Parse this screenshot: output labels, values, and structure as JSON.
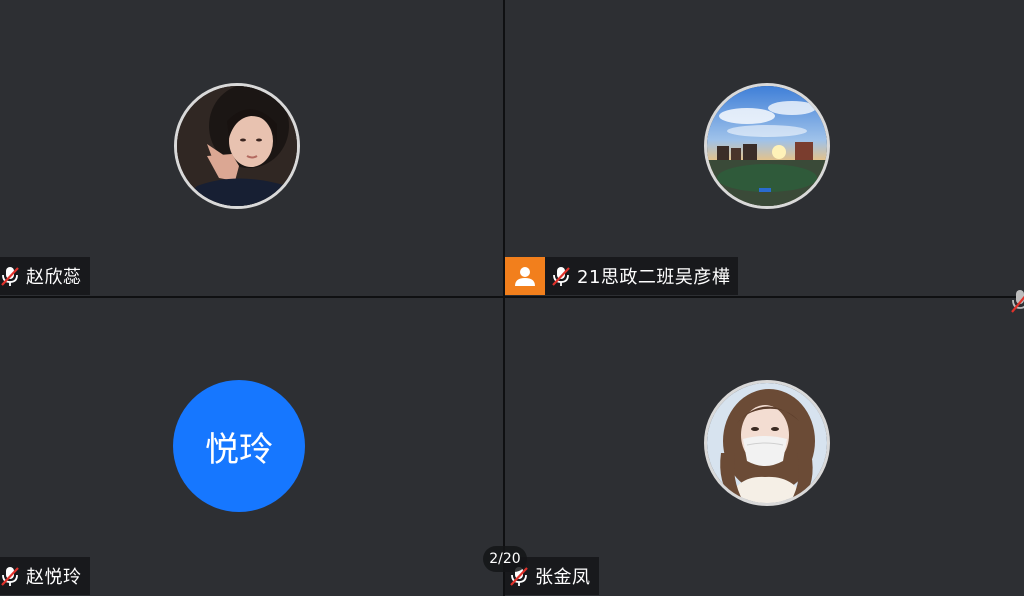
{
  "participants": [
    {
      "name": "赵欣蕊",
      "avatar": "photo-girl-peace-sign",
      "muted": true
    },
    {
      "name": "21思政二班吴彦樺",
      "avatar": "photo-sunset-campus",
      "muted": true,
      "is_host": true
    },
    {
      "name": "赵悦玲",
      "avatar_text": "悦玲",
      "avatar_color": "#1677ff",
      "muted": true
    },
    {
      "name": "张金凤",
      "avatar": "photo-girl-mask",
      "muted": true
    }
  ],
  "pagination": {
    "label": "2/20"
  },
  "colors": {
    "tile_bg": "#2d2f33",
    "host_badge": "#f27f1c",
    "muted_red": "#e0322b",
    "accent_blue": "#1677ff"
  }
}
